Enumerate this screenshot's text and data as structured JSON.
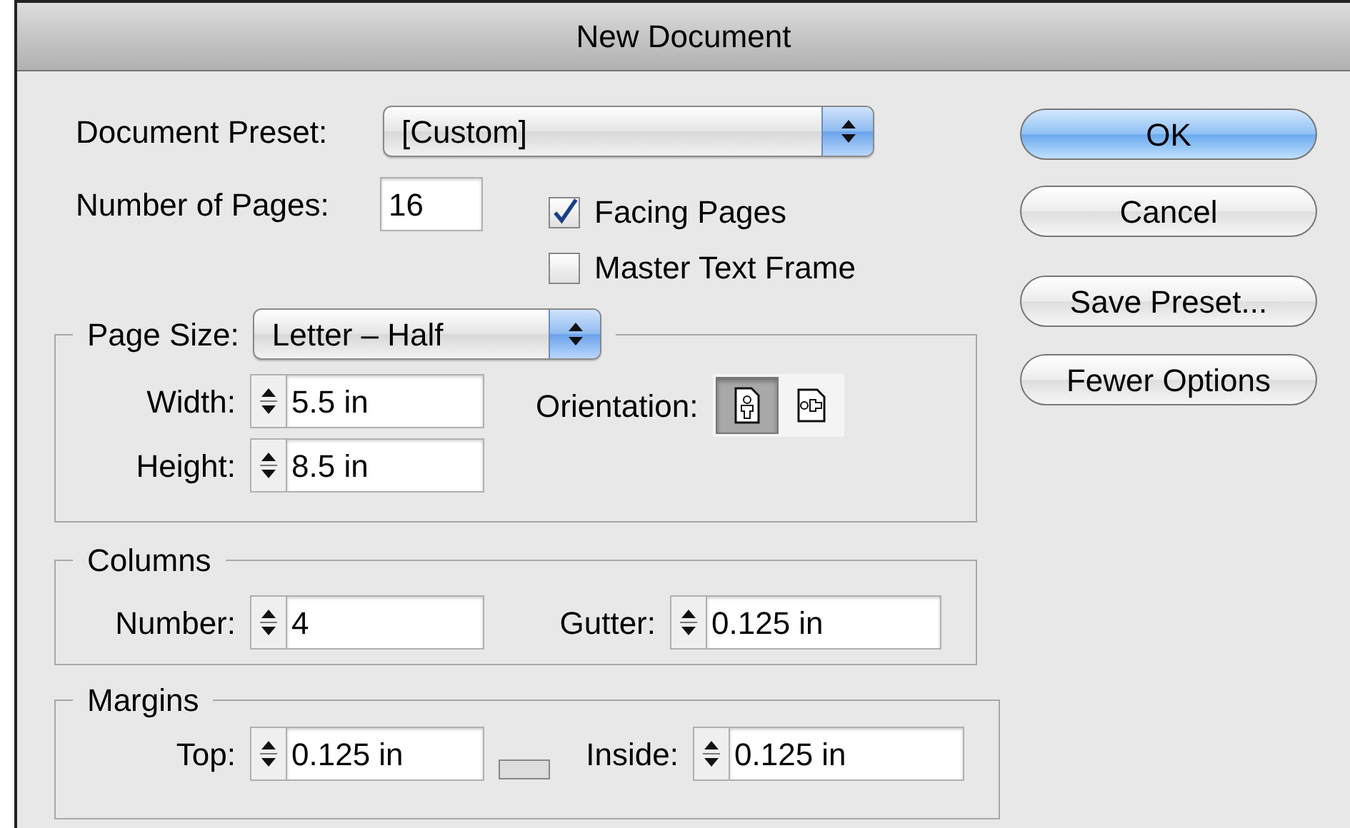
{
  "window": {
    "title": "New Document"
  },
  "document_preset": {
    "label": "Document Preset:",
    "value": "[Custom]"
  },
  "number_of_pages": {
    "label": "Number of Pages:",
    "value": "16"
  },
  "checkboxes": [
    {
      "label": "Facing Pages",
      "checked": true
    },
    {
      "label": "Master Text Frame",
      "checked": false
    }
  ],
  "buttons": [
    {
      "label": "OK",
      "default": true
    },
    {
      "label": "Cancel",
      "default": false
    },
    {
      "label": "Save Preset...",
      "default": false
    },
    {
      "label": "Fewer Options",
      "default": false
    }
  ],
  "page_size": {
    "label": "Page Size:",
    "value": "Letter – Half",
    "fields": [
      {
        "label": "Width:",
        "value": "5.5 in"
      },
      {
        "label": "Height:",
        "value": "8.5 in"
      }
    ],
    "orientation": {
      "label": "Orientation:",
      "options": [
        {
          "kind": "portrait",
          "selected": true
        },
        {
          "kind": "landscape",
          "selected": false
        }
      ]
    }
  },
  "columns": {
    "title": "Columns",
    "fields": [
      {
        "label": "Number:",
        "value": "4"
      },
      {
        "label": "Gutter:",
        "value": "0.125 in"
      }
    ]
  },
  "margins": {
    "title": "Margins",
    "fields": [
      {
        "label": "Top:",
        "value": "0.125 in"
      },
      {
        "label": "Inside:",
        "value": "0.125 in"
      }
    ]
  }
}
